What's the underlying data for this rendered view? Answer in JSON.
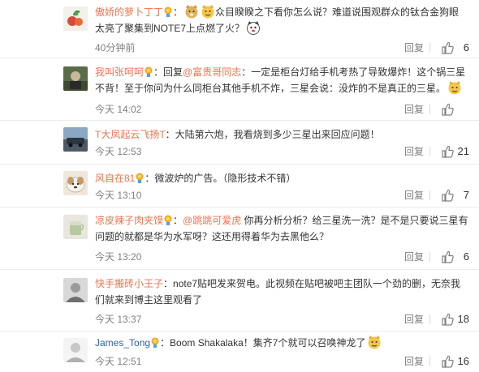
{
  "comments": [
    {
      "username": "傲娇的萝卜丁丁",
      "segments": [
        "：",
        "众目睽睽之下看你怎么说？难道说围观群众的钛合金狗眼太亮了聚集到NOTE7上点燃了火？"
      ],
      "time": "40分钟前",
      "reply": "回复",
      "likes": "6"
    },
    {
      "username": "我叫张呵呵",
      "segments": [
        "：回复",
        "@富贵哥同志",
        "：一定是柜台灯给手机考热了导致爆炸！这个锅三星不背！至于你问为什么同柜台其他手机不炸，三星会说：没炸的不是真正的三星。"
      ],
      "time": "今天 14:02",
      "reply": "回复",
      "likes": ""
    },
    {
      "username": "T大凤起云飞扬T",
      "segments": [
        "：大陆第六炮，我看烧到多少三星出来回应问题！"
      ],
      "time": "今天 12:53",
      "reply": "回复",
      "likes": "21"
    },
    {
      "username": "风自在81",
      "segments": [
        "：微波炉的广告。（隐形技术不错）"
      ],
      "time": "今天 13:10",
      "reply": "回复",
      "likes": "7"
    },
    {
      "username": "凉皮辣子肉夹馍",
      "segments": [
        "：",
        "@跳跳可爱虎",
        " 你再分析分析？给三星洗一洗？是不是只要说三星有问题的就都是华为水军呀？这还用得着华为去黑他么？"
      ],
      "time": "今天 13:20",
      "reply": "回复",
      "likes": "6"
    },
    {
      "username": "快手搬砖小王子",
      "segments": [
        "：note7贴吧发来贺电。此视频在贴吧被吧主团队一个劲的删，无奈我们就来到博主这里观看了"
      ],
      "time": "今天 13:37",
      "reply": "回复",
      "likes": "18"
    },
    {
      "username": "James_Tong",
      "segments": [
        "：Boom Shakalaka！集齐7个就可以召唤神龙了"
      ],
      "time": "今天 12:51",
      "reply": "回复",
      "likes": "16"
    }
  ],
  "colors": {
    "username": "#eb7350",
    "username_alt": "#2f62a8",
    "meta": "#808080",
    "divider": "#ececec"
  },
  "icons": [
    "member-badge-icon",
    "doge-emoji-icon",
    "thumbs-up-icon"
  ]
}
